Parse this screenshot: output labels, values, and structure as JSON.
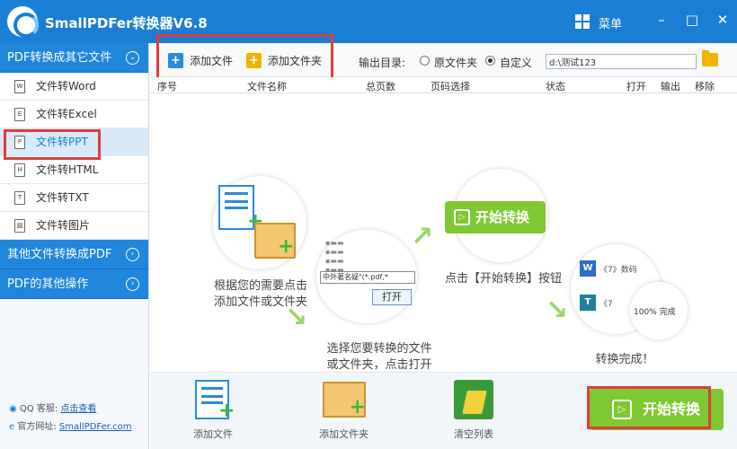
{
  "app": {
    "title": "SmallPDFer转换器V6.8",
    "menu_label": "菜单"
  },
  "window_controls": {
    "minimize": "–",
    "maximize": "□",
    "close": "✕"
  },
  "sidebar": {
    "category1": "PDF转换成其它文件",
    "items": [
      {
        "label": "文件转Word",
        "icon": "W"
      },
      {
        "label": "文件转Excel",
        "icon": "E"
      },
      {
        "label": "文件转PPT",
        "icon": "P"
      },
      {
        "label": "文件转HTML",
        "icon": "H"
      },
      {
        "label": "文件转TXT",
        "icon": "T"
      },
      {
        "label": "文件转图片",
        "icon": "▨"
      }
    ],
    "category2": "其他文件转换成PDF",
    "category3": "PDF的其他操作",
    "footer": {
      "qq_label": "QQ 客服:",
      "qq_link": "点击查看",
      "site_label": "官方网址:",
      "site_link": "SmallPDFer.com"
    }
  },
  "toolbar": {
    "add_file": "添加文件",
    "add_folder": "添加文件夹",
    "output_label": "输出目录:",
    "radio_original": "原文件夹",
    "radio_custom": "自定义",
    "path_value": "d:\\测试123"
  },
  "table_headers": {
    "index": "序号",
    "name": "文件名称",
    "pages": "总页数",
    "page_select": "页码选择",
    "status": "状态",
    "open": "打开",
    "output": "输出",
    "remove": "移除"
  },
  "steps": {
    "step1": "根据您的需要点击\n添加文件或文件夹",
    "step2": "选择您要转换的文件\n或文件夹，点击打开",
    "step2_file_label": "中外著名疑\"(*.pdf,*",
    "step2_open_button": "打开",
    "step3": "点击【开始转换】按钮",
    "step3_button": "开始转换",
    "step4": "转换完成！",
    "step4_row1": "《7》数码",
    "step4_row2": "《7",
    "step4_progress": "100%",
    "step4_done": "完成"
  },
  "bottom": {
    "add_file": "添加文件",
    "add_folder": "添加文件夹",
    "clear_list": "清空列表",
    "start": "开始转换"
  },
  "colors": {
    "brand_blue": "#1a7fd4",
    "accent_green": "#7ec832",
    "highlight_red": "#e23c3c"
  }
}
